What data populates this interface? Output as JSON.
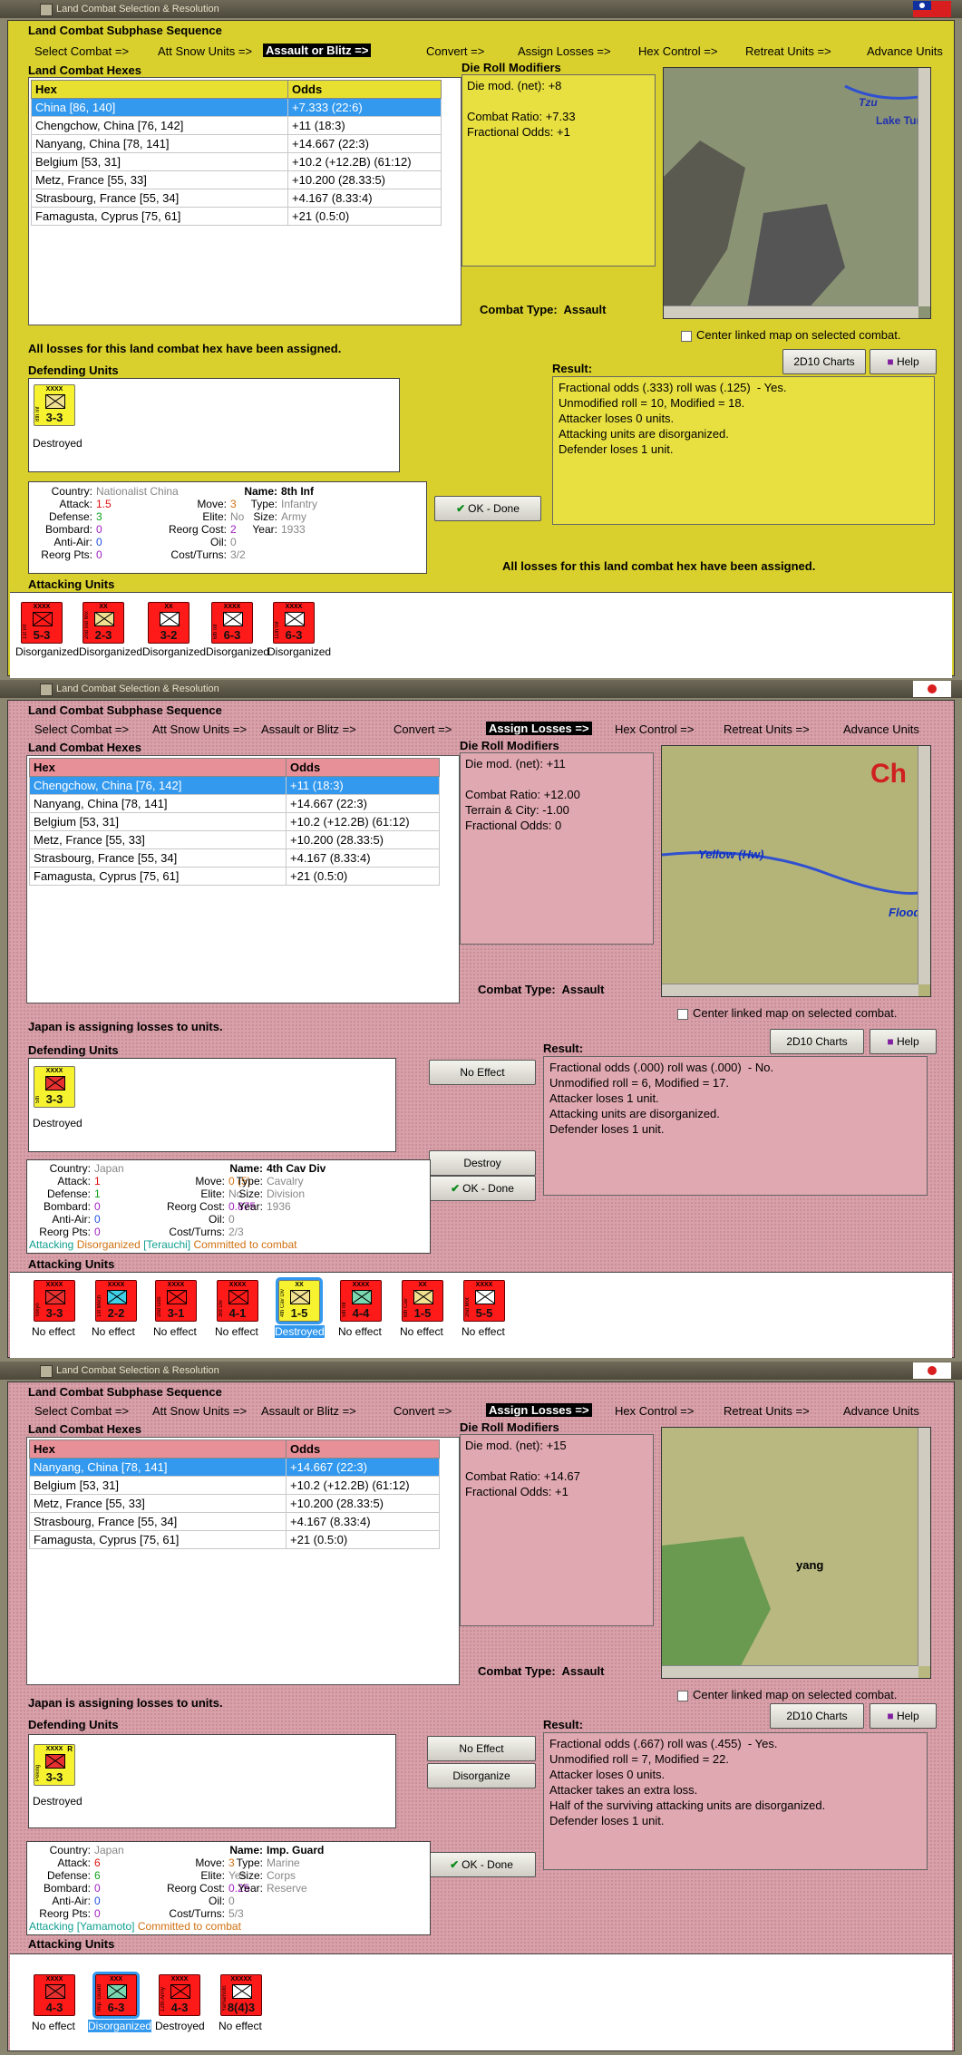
{
  "window_title": "Land Combat Selection & Resolution",
  "subphase_title": "Land Combat Subphase Sequence",
  "menu": [
    "Select Combat =>",
    "Att Snow Units =>",
    "Assault or Blitz =>",
    "Convert =>",
    "Assign Losses =>",
    "Hex Control =>",
    "Retreat Units =>",
    "Advance Units"
  ],
  "labels": {
    "land_combat_hexes": "Land Combat Hexes",
    "hex_col": "Hex",
    "odds_col": "Odds",
    "die_roll_modifiers": "Die Roll Modifiers",
    "combat_type_label": "Combat Type:",
    "combat_type_value": "Assault",
    "center_map": "Center linked map on selected combat.",
    "charts": "2D10 Charts",
    "help": "Help",
    "result": "Result:",
    "defending_units": "Defending Units",
    "attacking_units": "Attacking Units",
    "ok_done": "OK - Done",
    "no_effect": "No Effect",
    "destroy": "Destroy",
    "disorganize": "Disorganize",
    "info_country": "Country:",
    "info_attack": "Attack:",
    "info_defense": "Defense:",
    "info_bombard": "Bombard:",
    "info_antiair": "Anti-Air:",
    "info_reorgpts": "Reorg Pts:",
    "info_move": "Move:",
    "info_elite": "Elite:",
    "info_reorgcost": "Reorg Cost:",
    "info_oil": "Oil:",
    "info_costturns": "Cost/Turns:",
    "info_name": "Name:",
    "info_type": "Type:",
    "info_size": "Size:",
    "info_year": "Year:"
  },
  "panels": [
    {
      "theme_color": "#d9d02e",
      "selected_menu_index": 2,
      "hexes": [
        {
          "hex": "China [86, 140]",
          "odds": "+7.333 (22:6)"
        },
        {
          "hex": "Chengchow, China [76, 142]",
          "odds": "+11 (18:3)"
        },
        {
          "hex": "Nanyang, China [78, 141]",
          "odds": "+14.667 (22:3)"
        },
        {
          "hex": "Belgium [53, 31]",
          "odds": "+10.2 (+12.2B) (61:12)"
        },
        {
          "hex": "Metz, France [55, 33]",
          "odds": "+10.200 (28.33:5)"
        },
        {
          "hex": "Strasbourg, France [55, 34]",
          "odds": "+4.167 (8.33:4)"
        },
        {
          "hex": "Famagusta, Cyprus [75, 61]",
          "odds": "+21 (0.5:0)"
        }
      ],
      "die_mods": "Die mod. (net): +8\n\nCombat Ratio: +7.33\nFractional Odds: +1",
      "status": "All losses for this land combat hex have been assigned.",
      "bottom_status": "All losses for this land combat hex have been assigned.",
      "result": "Fractional odds (.333) roll was (.125)  - Yes.\nUnmodified roll = 10, Modified = 18.\nAttacker loses 0 units.\nAttacking units are disorganized.\nDefender loses 1 unit.",
      "defender": {
        "size": "XXXX",
        "name": "8th Inf",
        "strength": "3-3",
        "caption": "Destroyed",
        "color": "yellow"
      },
      "info": {
        "country": "Nationalist China",
        "attack": "1.5",
        "defense": "3",
        "bombard": "0",
        "antiair": "0",
        "reorg_pts": "0",
        "move": "3",
        "elite": "No",
        "reorg_cost": "2",
        "oil": "0",
        "cost_turns": "3/2",
        "name": "8th Inf",
        "type": "Infantry",
        "size": "Army",
        "year": "1933",
        "status_line": []
      },
      "attackers": [
        {
          "size": "XXXX",
          "name": "1st Inf",
          "strength": "5-3",
          "caption": "Disorganized",
          "color": "red"
        },
        {
          "size": "XX",
          "name": "2nd Ind Mix",
          "strength": "2-3",
          "caption": "Disorganized",
          "color": "red"
        },
        {
          "size": "XX",
          "name": "",
          "strength": "3-2",
          "caption": "Disorganized",
          "color": "red"
        },
        {
          "size": "XXXX",
          "name": "6th Inf",
          "strength": "6-3",
          "caption": "Disorganized",
          "color": "red"
        },
        {
          "size": "XXXX",
          "name": "11th Inf",
          "strength": "6-3",
          "caption": "Disorganized",
          "color": "red"
        }
      ]
    },
    {
      "theme_color": "#d8a0a8",
      "selected_menu_index": 4,
      "hexes": [
        {
          "hex": "Chengchow, China [76, 142]",
          "odds": "+11 (18:3)"
        },
        {
          "hex": "Nanyang, China [78, 141]",
          "odds": "+14.667 (22:3)"
        },
        {
          "hex": "Belgium [53, 31]",
          "odds": "+10.2 (+12.2B) (61:12)"
        },
        {
          "hex": "Metz, France [55, 33]",
          "odds": "+10.200 (28.33:5)"
        },
        {
          "hex": "Strasbourg, France [55, 34]",
          "odds": "+4.167 (8.33:4)"
        },
        {
          "hex": "Famagusta, Cyprus [75, 61]",
          "odds": "+21 (0.5:0)"
        }
      ],
      "die_mods": "Die mod. (net): +11\n\nCombat Ratio: +12.00\nTerrain & City: -1.00\nFractional Odds: 0",
      "status": "Japan is assigning losses to units.",
      "bottom_status": "",
      "result": "Fractional odds (.000) roll was (.000)  - No.\nUnmodified roll = 6, Modified = 17.\nAttacker loses 1 unit.\nAttacking units are disorganized.\nDefender loses 1 unit.",
      "defender": {
        "size": "XXXX",
        "name": "5th",
        "strength": "3-3",
        "caption": "Destroyed",
        "color": "yellow"
      },
      "info": {
        "country": "Japan",
        "attack": "1",
        "defense": "1",
        "bombard": "0",
        "antiair": "0",
        "reorg_pts": "0",
        "move": "0 (5)",
        "elite": "No",
        "reorg_cost": "0.875",
        "oil": "0",
        "cost_turns": "2/3",
        "name": "4th Cav Div",
        "type": "Cavalry",
        "size": "Division",
        "year": "1936",
        "status_line": [
          "Attacking",
          "Disorganized",
          "[Terauchi]",
          "Committed to combat"
        ]
      },
      "attackers": [
        {
          "size": "XXXX",
          "name": "Tokyo",
          "strength": "3-3",
          "caption": "No effect",
          "color": "red"
        },
        {
          "size": "XXXX",
          "name": "1st Mech",
          "strength": "2-2",
          "caption": "No effect",
          "color": "red"
        },
        {
          "size": "XXXX",
          "name": "2nd Gds",
          "strength": "3-1",
          "caption": "No effect",
          "color": "red"
        },
        {
          "size": "XXXX",
          "name": "3rd Div",
          "strength": "4-1",
          "caption": "No effect",
          "color": "red"
        },
        {
          "size": "XX",
          "name": "4th Cav Div",
          "strength": "1-5",
          "caption": "Destroyed",
          "color": "yellow"
        },
        {
          "size": "XXXX",
          "name": "5th Inf",
          "strength": "4-4",
          "caption": "No effect",
          "color": "red"
        },
        {
          "size": "XX",
          "name": "6th Cav",
          "strength": "1-5",
          "caption": "No effect",
          "color": "red"
        },
        {
          "size": "XXXX",
          "name": "2nd Mot",
          "strength": "5-5",
          "caption": "No effect",
          "color": "red"
        }
      ]
    },
    {
      "theme_color": "#d8a0a8",
      "selected_menu_index": 4,
      "hexes": [
        {
          "hex": "Nanyang, China [78, 141]",
          "odds": "+14.667 (22:3)"
        },
        {
          "hex": "Belgium [53, 31]",
          "odds": "+10.2 (+12.2B) (61:12)"
        },
        {
          "hex": "Metz, France [55, 33]",
          "odds": "+10.200 (28.33:5)"
        },
        {
          "hex": "Strasbourg, France [55, 34]",
          "odds": "+4.167 (8.33:4)"
        },
        {
          "hex": "Famagusta, Cyprus [75, 61]",
          "odds": "+21 (0.5:0)"
        }
      ],
      "die_mods": "Die mod. (net): +15\n\nCombat Ratio: +14.67\nFractional Odds: +1",
      "status": "Japan is assigning losses to units.",
      "bottom_status": "",
      "result": "Fractional odds (.667) roll was (.455)  - Yes.\nUnmodified roll = 7, Modified = 22.\nAttacker loses 0 units.\nAttacker takes an extra loss.\nHalf of the surviving attacking units are disorganized.\nDefender loses 1 unit.",
      "defender": {
        "size": "XXXX",
        "name": "Peking",
        "strength": "3-3",
        "caption": "Destroyed",
        "color": "yellow"
      },
      "info": {
        "country": "Japan",
        "attack": "6",
        "defense": "6",
        "bombard": "0",
        "antiair": "0",
        "reorg_pts": "0",
        "move": "3",
        "elite": "Yes",
        "reorg_cost": "0.25",
        "oil": "0",
        "cost_turns": "5/3",
        "name": "Imp. Guard",
        "type": "Marine",
        "size": "Corps",
        "year": "Reserve",
        "status_line": [
          "Attacking",
          "[Yamamoto]",
          "Committed to combat"
        ]
      },
      "attackers": [
        {
          "size": "XXXX",
          "name": "",
          "strength": "4-3",
          "caption": "No effect",
          "color": "red"
        },
        {
          "size": "XXX",
          "name": "Imp. Guard",
          "strength": "6-3",
          "caption": "Disorganized",
          "color": "red"
        },
        {
          "size": "XXXX",
          "name": "12th Army",
          "strength": "4-3",
          "caption": "Destroyed",
          "color": "red"
        },
        {
          "size": "XXXXX",
          "name": "Yamamoto",
          "strength": "8(4)3",
          "caption": "No effect",
          "color": "red"
        }
      ]
    }
  ]
}
